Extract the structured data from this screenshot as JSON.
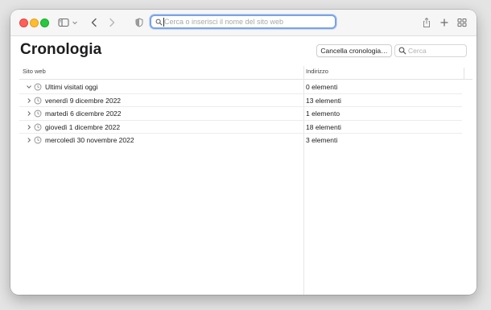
{
  "toolbar": {
    "address_placeholder": "Cerca o inserisci il nome del sito web"
  },
  "page": {
    "title": "Cronologia",
    "clear_button_label": "Cancella cronologia…",
    "search_placeholder": "Cerca"
  },
  "table": {
    "columns": [
      "Sito web",
      "Indirizzo"
    ],
    "rows": [
      {
        "label": "Ultimi visitati oggi",
        "count": "0 elementi",
        "expanded": true
      },
      {
        "label": "venerdì 9 dicembre 2022",
        "count": "13 elementi",
        "expanded": false
      },
      {
        "label": "martedì 6 dicembre 2022",
        "count": "1 elemento",
        "expanded": false
      },
      {
        "label": "giovedì 1 dicembre 2022",
        "count": "18 elementi",
        "expanded": false
      },
      {
        "label": "mercoledì 30 novembre 2022",
        "count": "3 elementi",
        "expanded": false
      }
    ]
  },
  "icons": {
    "sidebar": "sidebar-icon",
    "back": "chevron-left-icon",
    "forward": "chevron-right-icon",
    "privacy": "shield-icon",
    "share": "share-icon",
    "new_tab": "plus-icon",
    "tab_overview": "tab-overview-icon"
  },
  "colors": {
    "close": "#ff5f57",
    "minimize": "#febc2e",
    "zoom": "#28c840",
    "focus_ring": "#7aa3e5"
  }
}
